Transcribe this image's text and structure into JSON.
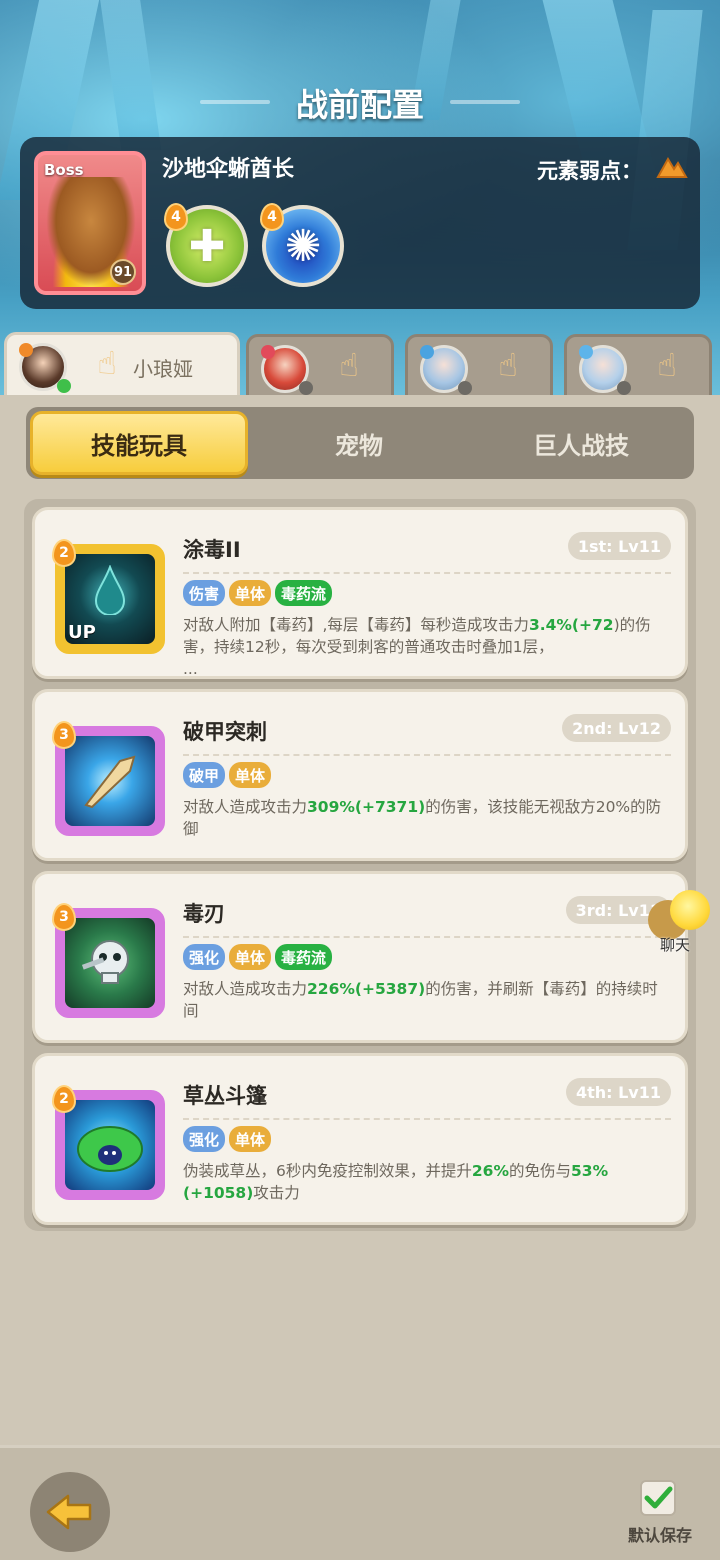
{
  "header": {
    "title": "战前配置"
  },
  "boss": {
    "tag": "Boss",
    "level": "91",
    "name": "沙地伞蜥酋长",
    "weakness_label": "元素弱点：",
    "weakness_icon": "earth-element-icon",
    "skills": [
      {
        "level": "4",
        "icon": "heal-plus-icon"
      },
      {
        "level": "4",
        "icon": "water-splash-icon"
      }
    ]
  },
  "heroes": [
    {
      "name": "小琅娅",
      "active": true
    },
    {
      "name": "",
      "active": false
    },
    {
      "name": "",
      "active": false
    },
    {
      "name": "",
      "active": false
    }
  ],
  "subtabs": [
    "技能玩具",
    "宠物",
    "巨人战技"
  ],
  "skills": [
    {
      "level": "2",
      "title": "涂毒II",
      "slot": "1st: Lv11",
      "up": "UP",
      "tags": [
        "伤害",
        "单体",
        "毒药流"
      ],
      "desc_pre": "对敌人附加【毒药】,每层【毒药】每秒造成攻击力",
      "desc_hl1": "3.4%(+72",
      "desc_mid": ")的伤害，持续12秒，每次受到刺客的普通攻击时叠加1层，",
      "desc_more": "..."
    },
    {
      "level": "3",
      "title": "破甲突刺",
      "slot": "2nd: Lv12",
      "tags": [
        "破甲",
        "单体"
      ],
      "desc_pre": "对敌人造成攻击力",
      "desc_hl1": "309%(+7371)",
      "desc_mid": "的伤害，该技能无视敌方20%的防御"
    },
    {
      "level": "3",
      "title": "毒刃",
      "slot": "3rd: Lv11",
      "tags": [
        "强化",
        "单体",
        "毒药流"
      ],
      "desc_pre": "对敌人造成攻击力",
      "desc_hl1": "226%(+5387)",
      "desc_mid": "的伤害，并刷新【毒药】的持续时间"
    },
    {
      "level": "2",
      "title": "草丛斗篷",
      "slot": "4th: Lv11",
      "tags": [
        "强化",
        "单体"
      ],
      "desc_pre": "伪装成草丛，6秒内免疫控制效果，并提升",
      "desc_hl1": "26%",
      "desc_mid": "的免伤与",
      "desc_hl2": "53%(+1058)",
      "desc_post": "攻击力"
    }
  ],
  "chat": {
    "label": "聊天"
  },
  "footer": {
    "save_label": "默认保存"
  },
  "colors": {
    "accent_yellow": "#f7cd3c",
    "highlight_green": "#26a640",
    "tag_blue": "#6b9fe0",
    "tag_gold": "#e9ad3a",
    "tag_green": "#28b142"
  }
}
